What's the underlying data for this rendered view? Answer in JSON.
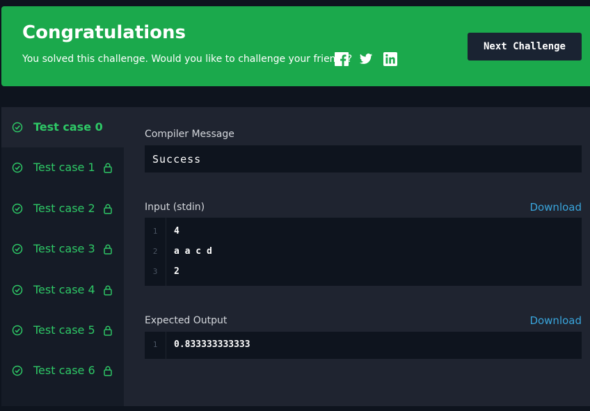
{
  "banner": {
    "title": "Congratulations",
    "subtitle": "You solved this challenge. Would you like to challenge your friends?",
    "share_icons": [
      "facebook-icon",
      "twitter-icon",
      "linkedin-icon"
    ],
    "next_button": "Next Challenge",
    "color": "#1ba94c"
  },
  "sidebar": {
    "items": [
      {
        "label": "Test case 0",
        "status": "passed",
        "locked": false,
        "active": true
      },
      {
        "label": "Test case 1",
        "status": "passed",
        "locked": true,
        "active": false
      },
      {
        "label": "Test case 2",
        "status": "passed",
        "locked": true,
        "active": false
      },
      {
        "label": "Test case 3",
        "status": "passed",
        "locked": true,
        "active": false
      },
      {
        "label": "Test case 4",
        "status": "passed",
        "locked": true,
        "active": false
      },
      {
        "label": "Test case 5",
        "status": "passed",
        "locked": true,
        "active": false
      },
      {
        "label": "Test case 6",
        "status": "passed",
        "locked": true,
        "active": false
      }
    ],
    "pass_color": "#2ec866"
  },
  "compiler": {
    "label": "Compiler Message",
    "message": "Success"
  },
  "input": {
    "label": "Input (stdin)",
    "download": "Download",
    "lines": [
      {
        "n": "1",
        "text": "4"
      },
      {
        "n": "2",
        "text": "a a c d"
      },
      {
        "n": "3",
        "text": "2"
      }
    ]
  },
  "expected": {
    "label": "Expected Output",
    "download": "Download",
    "lines": [
      {
        "n": "1",
        "text": "0.833333333333"
      }
    ]
  },
  "link_color": "#39a5dc"
}
